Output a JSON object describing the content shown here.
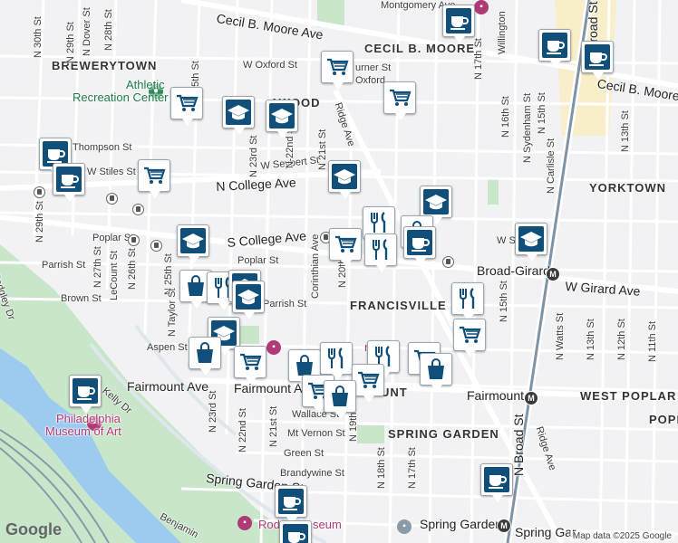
{
  "map": {
    "neighborhoods": [
      {
        "id": "brewerytown",
        "text": "BREWERYTOWN"
      },
      {
        "id": "cecil-b-moore",
        "text": "CECIL B. MOORE"
      },
      {
        "id": "yorktown",
        "text": "YORKTOWN"
      },
      {
        "id": "francisville",
        "text": "FRANCISVILLE"
      },
      {
        "id": "west-poplar",
        "text": "WEST POPLAR"
      },
      {
        "id": "popl",
        "text": "POPL"
      },
      {
        "id": "spring-garden",
        "text": "SPRING GARDEN"
      },
      {
        "id": "fairmount-area",
        "text": "UNT"
      },
      {
        "id": "lawood",
        "text": "AWOOD"
      }
    ],
    "streets": {
      "cecil_b_moore_ave": "Cecil B. Moore Ave",
      "cecil_b_moore_ave_east": "Cecil B. Moore Ave",
      "montgomery_ave": "Montgomery Ave",
      "w_oxford_st": "W Oxford St",
      "oxford": "Oxford",
      "turner_st": "urner St",
      "thompson_st": "Thompson St",
      "w_stiles_st": "W Stiles St",
      "w_seybert_st": "W Seybert St",
      "n_college_ave": "N College Ave",
      "s_college_ave": "S College Ave",
      "poplar_st": "Poplar St",
      "poplar_st_2": "Poplar St",
      "parrish_st": "Parrish St",
      "parrish_st_2": "Parrish St",
      "brown_st": "Brown St",
      "aspen_st": "Aspen St",
      "fairmount_ave": "Fairmount Ave",
      "fairmount_ave_2": "Fairmount Av",
      "wallace_st": "Wallace St",
      "mt_vernon_st": "Mt Vernon St",
      "green_st": "Green St",
      "brandywine_st": "Brandywine St",
      "spring_garden_st": "Spring Garden St",
      "spring_garden_st_2": "Spring Gar",
      "broad_girard": "Broad-Girard",
      "w_girard_ave": "W Girard Ave",
      "fairmount_station": "Fairmount",
      "spring_garden_station": "Spring Garden",
      "w_st": "W S",
      "ridge_ave": "Ridge Ave",
      "ridge_ave_2": "Ridge Ave",
      "corinthian_ave": "Corinthian Ave",
      "kelly_dr": "Kelly Dr",
      "benjamin": "Benjamin",
      "sedgley_dr": "Sedgley Dr",
      "willington": "Willington",
      "n_30th_st": "N 30th St",
      "n_29th_st": "N 29th St",
      "n_29th_st_2": "N 29th St",
      "n_dover_st": "N Dover St",
      "n_28th_st": "N 28th St",
      "n_27th_st": "N 27th St",
      "lecount_st": "LeCount St",
      "n_26th_st": "N 26th St",
      "n_25th_st": "N 25th St",
      "n_25th_st_top": "25th St",
      "n_taylor_st": "N Taylor St",
      "n_23rd_st": "N 23rd St",
      "n_23rd_st_2": "N 23rd St",
      "n_22nd_st": "N 22nd St",
      "n_22nd_st_2": "N 22nd St",
      "n_21st_st": "N 21st St",
      "n_21st_st_2": "N 21st St",
      "n_20th": "N 20th",
      "n_19th_st": "N 19th St",
      "n_18th_st": "N 18th St",
      "n_17th_st": "N 17th St",
      "n_17th_st_2": "N 17th St",
      "n_16th_st": "N 16th St",
      "n_15th_st": "N 15th St",
      "n_15th_st_2": "N 15th St",
      "n_sydenham_st": "N Sydenham St",
      "n_carlisle_st": "N Carlisle St",
      "n_broad_st": "N Broad St",
      "n_broad_st_2": "N Broad St",
      "n_13th_st": "N 13th St",
      "n_13th_st_2": "N 13th St",
      "n_12th_st": "N 12th St",
      "n_11th_st": "N 11th St",
      "n_watts_st": "N Watts St"
    },
    "pois": {
      "athletic_center": "Athletic\nRecreation Center",
      "athletic_line1": "Athletic",
      "athletic_line2": "Recreation Center",
      "museum_line1": "Philadelphia",
      "museum_line2": "Museum of Art",
      "rodin": "Rod",
      "rodin_2": "seum",
      "ts_fragment": "rt"
    },
    "markers": [
      {
        "type": "coffee-icon"
      },
      {
        "type": "cart-icon"
      },
      {
        "type": "school-icon"
      },
      {
        "type": "restaurant-icon"
      },
      {
        "type": "bag-icon"
      }
    ],
    "colors": {
      "marker_fill": "#0f4f7a",
      "park": "#c8e6c9",
      "water": "#9dcbf0",
      "rail": "#8a9aa8",
      "campus": "#f8eec9"
    },
    "attribution": {
      "logo": "Google",
      "credit": "Map data ©2025 Google"
    }
  }
}
